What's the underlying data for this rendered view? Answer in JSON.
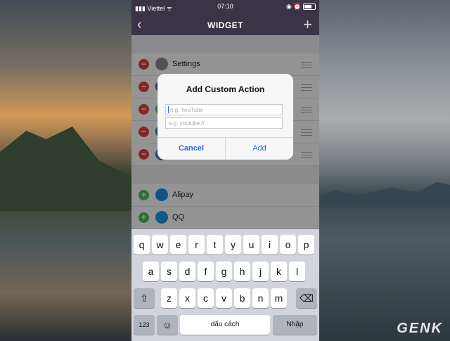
{
  "status": {
    "carrier": "Viettel",
    "time": "07:10"
  },
  "nav": {
    "title": "WIDGET",
    "back": "‹",
    "add": "+"
  },
  "widgets": [
    {
      "label": "Settings",
      "state": "active"
    },
    {
      "label": "",
      "state": "active"
    },
    {
      "label": "",
      "state": "active"
    },
    {
      "label": "",
      "state": "active"
    },
    {
      "label": "",
      "state": "active"
    }
  ],
  "more_widgets": [
    {
      "label": "Alipay"
    },
    {
      "label": "QQ"
    }
  ],
  "dialog": {
    "title": "Add Custom Action",
    "name_placeholder": "e.g. YouTube",
    "url_placeholder": "e.g. youtube://",
    "cancel": "Cancel",
    "add": "Add"
  },
  "keyboard": {
    "row1": [
      "q",
      "w",
      "e",
      "r",
      "t",
      "y",
      "u",
      "i",
      "o",
      "p"
    ],
    "row2": [
      "a",
      "s",
      "d",
      "f",
      "g",
      "h",
      "j",
      "k",
      "l"
    ],
    "row3": [
      "z",
      "x",
      "c",
      "v",
      "b",
      "n",
      "m"
    ],
    "numbers": "123",
    "space": "dấu cách",
    "return": "Nhập"
  },
  "watermark": "GENK",
  "colors": {
    "accent": "#2a6bd8",
    "remove": "#e94141",
    "insert": "#4cc15a",
    "navbar": "#3b3446"
  }
}
